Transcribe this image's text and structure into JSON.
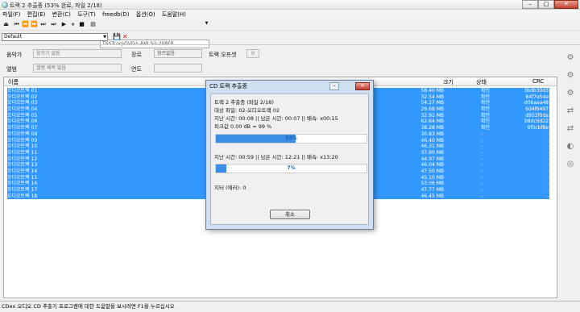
{
  "window": {
    "title": "트랙 2 추출중 (53% 완료, 파일 2/18)",
    "min": "–",
    "max": "□",
    "close": "✕"
  },
  "menu": [
    "파일(F)",
    "편집(E)",
    "변환(C)",
    "도구(T)",
    "freedb(D)",
    "옵션(O)",
    "도움말(H)"
  ],
  "toolbar": {
    "drive": "TSSTcorpDVD+-RW SU-208FB"
  },
  "preset": {
    "value": "Default"
  },
  "album": {
    "artist_label": "음악가",
    "artist_value": "음악가 없음",
    "genre_label": "장르",
    "genre_value": "장르없음",
    "offset_label": "트랙 오프셋",
    "offset_value": "0",
    "album_label": "앨범",
    "album_value": "앨범 제목 없음",
    "year_label": "연도",
    "year_value": ""
  },
  "list": {
    "headers": {
      "name": "이름",
      "size": "크기",
      "status": "상태",
      "crc": "CRC"
    },
    "rows": [
      {
        "name": "오디오트랙 01",
        "size": "58.40 MB",
        "status": "확인",
        "crc": "3bdb30d3"
      },
      {
        "name": "오디오트랙 02",
        "size": "32.54 MB",
        "status": "확인",
        "crc": "84f7e54e"
      },
      {
        "name": "오디오트랙 03",
        "size": "54.27 MB",
        "status": "확인",
        "crc": "d06aaa48"
      },
      {
        "name": "오디오트랙 04",
        "size": "29.68 MB",
        "status": "확인",
        "crc": "6d4f6497"
      },
      {
        "name": "오디오트랙 05",
        "size": "32.91 MB",
        "status": "확인",
        "crc": "d953f0da"
      },
      {
        "name": "오디오트랙 06",
        "size": "62.64 MB",
        "status": "확인",
        "crc": "b8dc6d22"
      },
      {
        "name": "오디오트랙 07",
        "size": "38.28 MB",
        "status": "확인",
        "crc": "9f0cbf8e"
      },
      {
        "name": "오디오트랙 08",
        "size": "30.83 MB",
        "status": "-",
        "crc": "-"
      },
      {
        "name": "오디오트랙 09",
        "size": "46.40 MB",
        "status": "-",
        "crc": "-"
      },
      {
        "name": "오디오트랙 10",
        "size": "46.31 MB",
        "status": "-",
        "crc": "-"
      },
      {
        "name": "오디오트랙 11",
        "size": "37.90 MB",
        "status": "-",
        "crc": "-"
      },
      {
        "name": "오디오트랙 12",
        "size": "44.97 MB",
        "status": "-",
        "crc": "-"
      },
      {
        "name": "오디오트랙 13",
        "size": "46.04 MB",
        "status": "-",
        "crc": "-"
      },
      {
        "name": "오디오트랙 14",
        "size": "47.50 MB",
        "status": "-",
        "crc": "-"
      },
      {
        "name": "오디오트랙 15",
        "size": "45.10 MB",
        "status": "-",
        "crc": "-"
      },
      {
        "name": "오디오트랙 16",
        "size": "53.06 MB",
        "status": "-",
        "crc": "-"
      },
      {
        "name": "오디오트랙 17",
        "size": "47.77 MB",
        "status": "-",
        "crc": "-"
      },
      {
        "name": "오디오트랙 18",
        "size": "46.45 MB",
        "status": "-",
        "crc": "-"
      }
    ]
  },
  "dialog": {
    "title": "CD 트랙 추출중",
    "line1": "트랙 2 추출중 (파일 2/18)",
    "line2": "대상 파일: 02-오디오트랙 02",
    "line3": "지난 시간: 00:08 || 남은 시간: 00:07 || 배속: x00:15",
    "line4": "피크값 0.00 dB = 99 %",
    "progress1": 0.53,
    "progress1_label": "53%",
    "line5": "지난 시간: 00:59 || 남은 시간: 12:21 || 배속: x13:20",
    "progress2": 0.07,
    "progress2_label": "7%",
    "line6": "지터 (에러): 0",
    "cancel": "취소"
  },
  "status": "CDex 오디오 CD 추출기 프로그램에 대한 도움말을 보시려면 F1을 누르십시오"
}
